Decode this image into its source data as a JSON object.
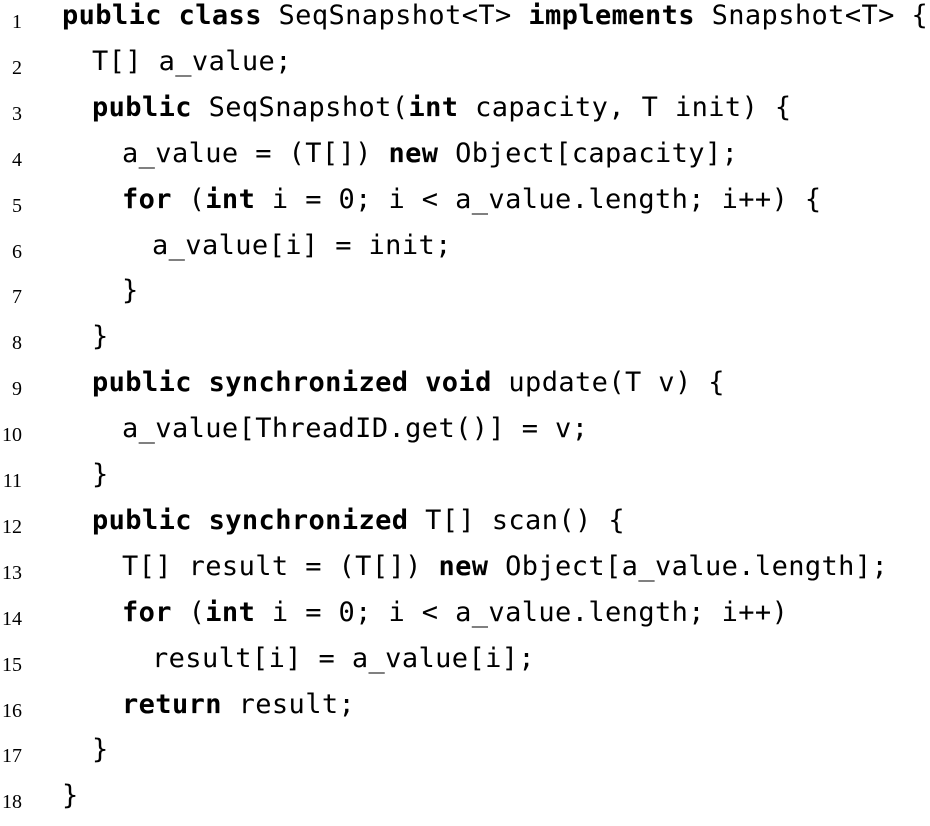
{
  "lines": [
    {
      "number": "1",
      "indent": 0,
      "tokens": [
        {
          "t": "public",
          "k": true
        },
        {
          "t": " "
        },
        {
          "t": "class",
          "k": true
        },
        {
          "t": " SeqSnapshot<T> "
        },
        {
          "t": "implements",
          "k": true
        },
        {
          "t": " Snapshot<T> {"
        }
      ]
    },
    {
      "number": "2",
      "indent": 1,
      "tokens": [
        {
          "t": "T[] a_value;"
        }
      ]
    },
    {
      "number": "3",
      "indent": 1,
      "tokens": [
        {
          "t": "public",
          "k": true
        },
        {
          "t": " SeqSnapshot("
        },
        {
          "t": "int",
          "k": true
        },
        {
          "t": " capacity, T init) {"
        }
      ]
    },
    {
      "number": "4",
      "indent": 2,
      "tokens": [
        {
          "t": "a_value = (T[]) "
        },
        {
          "t": "new",
          "k": true
        },
        {
          "t": " Object[capacity];"
        }
      ]
    },
    {
      "number": "5",
      "indent": 2,
      "tokens": [
        {
          "t": "for",
          "k": true
        },
        {
          "t": " ("
        },
        {
          "t": "int",
          "k": true
        },
        {
          "t": " i = 0; i < a_value.length; i++) {"
        }
      ]
    },
    {
      "number": "6",
      "indent": 3,
      "tokens": [
        {
          "t": "a_value[i] = init;"
        }
      ]
    },
    {
      "number": "7",
      "indent": 2,
      "tokens": [
        {
          "t": "}"
        }
      ]
    },
    {
      "number": "8",
      "indent": 1,
      "tokens": [
        {
          "t": "}"
        }
      ]
    },
    {
      "number": "9",
      "indent": 1,
      "tokens": [
        {
          "t": "public",
          "k": true
        },
        {
          "t": " "
        },
        {
          "t": "synchronized",
          "k": true
        },
        {
          "t": " "
        },
        {
          "t": "void",
          "k": true
        },
        {
          "t": " update(T v) {"
        }
      ]
    },
    {
      "number": "10",
      "indent": 2,
      "tokens": [
        {
          "t": "a_value[ThreadID.get()] = v;"
        }
      ]
    },
    {
      "number": "11",
      "indent": 1,
      "tokens": [
        {
          "t": "}"
        }
      ]
    },
    {
      "number": "12",
      "indent": 1,
      "tokens": [
        {
          "t": "public",
          "k": true
        },
        {
          "t": " "
        },
        {
          "t": "synchronized",
          "k": true
        },
        {
          "t": " T[] scan() {"
        }
      ]
    },
    {
      "number": "13",
      "indent": 2,
      "tokens": [
        {
          "t": "T[] result = (T[]) "
        },
        {
          "t": "new",
          "k": true
        },
        {
          "t": " Object[a_value.length];"
        }
      ]
    },
    {
      "number": "14",
      "indent": 2,
      "tokens": [
        {
          "t": "for",
          "k": true
        },
        {
          "t": " ("
        },
        {
          "t": "int",
          "k": true
        },
        {
          "t": " i = 0; i < a_value.length; i++)"
        }
      ]
    },
    {
      "number": "15",
      "indent": 3,
      "tokens": [
        {
          "t": "result[i] = a_value[i];"
        }
      ]
    },
    {
      "number": "16",
      "indent": 2,
      "tokens": [
        {
          "t": "return",
          "k": true
        },
        {
          "t": " result;"
        }
      ]
    },
    {
      "number": "17",
      "indent": 1,
      "tokens": [
        {
          "t": "}"
        }
      ]
    },
    {
      "number": "18",
      "indent": 0,
      "tokens": [
        {
          "t": "}"
        }
      ]
    }
  ]
}
